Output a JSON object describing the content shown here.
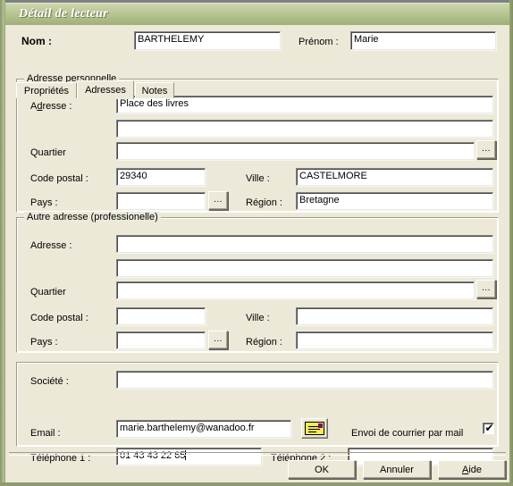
{
  "window": {
    "title": "Détail de lecteur"
  },
  "header": {
    "nom_label": "Nom :",
    "nom_value": "BARTHELEMY",
    "prenom_label": "Prénom :",
    "prenom_value": "Marie"
  },
  "tabs": [
    {
      "label": "Propriétés",
      "active": false
    },
    {
      "label": "Adresses",
      "active": true
    },
    {
      "label": "Notes",
      "active": false
    }
  ],
  "personal_address": {
    "group_title": "Adresse personnelle",
    "adresse_label_pre": "A",
    "adresse_label_accel": "d",
    "adresse_label_post": "resse :",
    "adresse_line1": "Place des livres",
    "adresse_line2": "",
    "quartier_label": "Quartier",
    "quartier_value": "",
    "quartier_browse": "...",
    "code_postal_label": "Code postal :",
    "code_postal_value": "29340",
    "ville_label": "Ville :",
    "ville_value": "CASTELMORE",
    "pays_label": "Pays :",
    "pays_value": "",
    "pays_browse": "...",
    "region_label": "Région :",
    "region_value": "Bretagne"
  },
  "professional_address": {
    "group_title": "Autre adresse (professionelle)",
    "adresse_label": "Adresse :",
    "adresse_line1": "",
    "adresse_line2": "",
    "quartier_label": "Quartier",
    "quartier_value": "",
    "quartier_browse": "...",
    "code_postal_label": "Code postal :",
    "code_postal_value": "",
    "ville_label": "Ville :",
    "ville_value": "",
    "pays_label": "Pays :",
    "pays_value": "",
    "pays_browse": "...",
    "region_label": "Région :",
    "region_value": ""
  },
  "contact": {
    "societe_label": "Société :",
    "societe_value": "",
    "email_label": "Email :",
    "email_value": "marie.barthelemy@wanadoo.fr",
    "mail_icon": "envelope-icon",
    "envoi_label": "Envoi de courrier par mail",
    "envoi_checked": true,
    "envoi_tick": "✔",
    "tel1_label": "Téléphone 1 :",
    "tel1_value": "01 43 43 22 65",
    "tel2_label": "Téléphone 2 :",
    "tel2_value": ""
  },
  "footer": {
    "ok_label": "OK",
    "cancel_label": "Annuler",
    "help_label_accel": "A",
    "help_label_rest": "ide"
  },
  "colors": {
    "title_gradient_start": "#cdd7af",
    "title_gradient_end": "#9dae76",
    "dialog_face": "#ece9d8",
    "field_bg": "#ffffff",
    "envelope_yellow": "#f2ea5a",
    "stamp_purple": "#7b0a6e",
    "desktop": "#808080"
  }
}
